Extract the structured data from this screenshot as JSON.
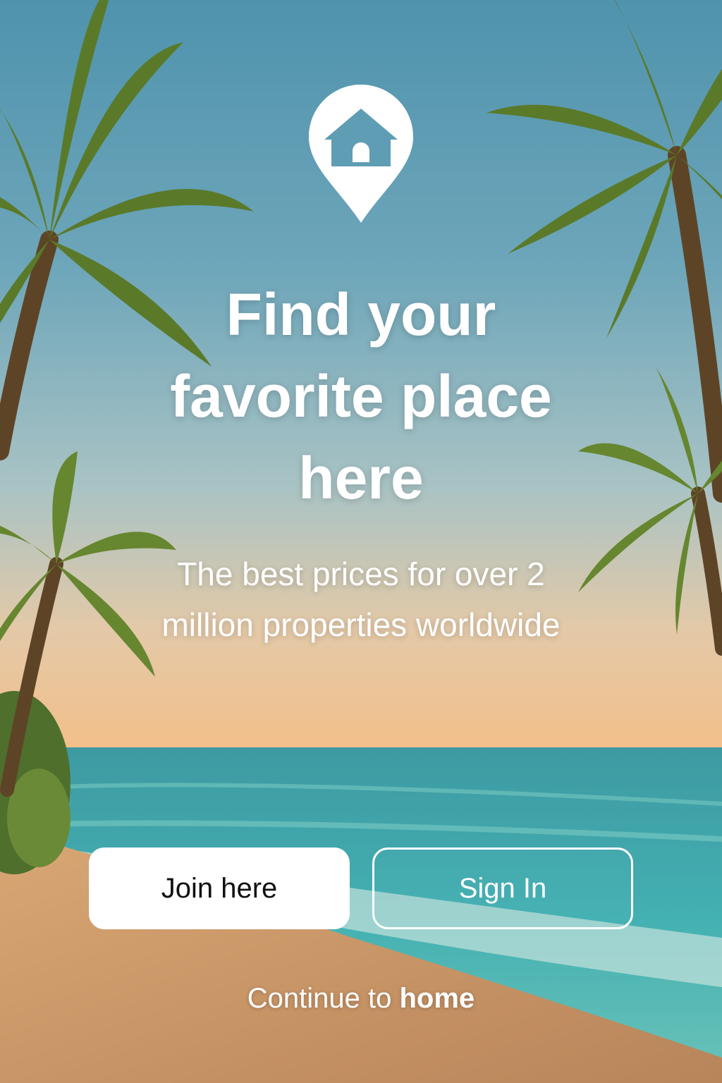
{
  "hero": {
    "icon": "home-location-pin-icon",
    "title_lines": [
      "Find your",
      "favorite place",
      "here"
    ],
    "subtitle_lines": [
      "The best prices for over 2",
      "million properties worldwide"
    ]
  },
  "actions": {
    "join_label": "Join here",
    "signin_label": "Sign In"
  },
  "footer": {
    "continue_prefix": "Continue to ",
    "continue_link": "home"
  },
  "colors": {
    "text": "#ffffff",
    "primary_button_bg": "#ffffff",
    "primary_button_text": "#111111"
  }
}
